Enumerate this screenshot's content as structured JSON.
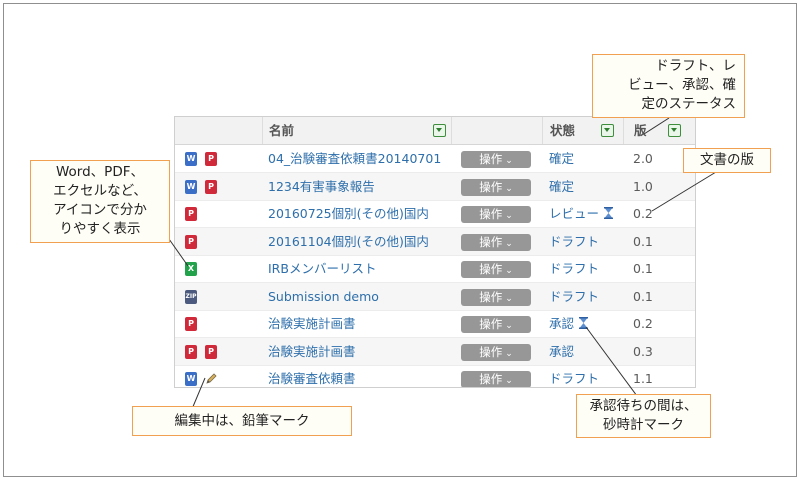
{
  "table": {
    "headers": {
      "name": "名前",
      "state": "状態",
      "version": "版"
    },
    "rows": [
      {
        "icons": [
          "W",
          "P"
        ],
        "name": "04_治験審査依頼書20140701",
        "op": "操作",
        "state": "確定",
        "hourglass": false,
        "version": "2.0"
      },
      {
        "icons": [
          "W",
          "P"
        ],
        "name": "1234有害事象報告",
        "op": "操作",
        "state": "確定",
        "hourglass": false,
        "version": "1.0"
      },
      {
        "icons": [
          "P"
        ],
        "name": "20160725個別(その他)国内",
        "op": "操作",
        "state": "レビュー",
        "hourglass": true,
        "version": "0.2"
      },
      {
        "icons": [
          "P"
        ],
        "name": "20161104個別(その他)国内",
        "op": "操作",
        "state": "ドラフト",
        "hourglass": false,
        "version": "0.1"
      },
      {
        "icons": [
          "X"
        ],
        "name": "IRBメンバーリスト",
        "op": "操作",
        "state": "ドラフト",
        "hourglass": false,
        "version": "0.1"
      },
      {
        "icons": [
          "ZIP"
        ],
        "name": "Submission demo",
        "op": "操作",
        "state": "ドラフト",
        "hourglass": false,
        "version": "0.1"
      },
      {
        "icons": [
          "P"
        ],
        "name": "治験実施計画書",
        "op": "操作",
        "state": "承認",
        "hourglass": true,
        "version": "0.2"
      },
      {
        "icons": [
          "P",
          "P"
        ],
        "name": "治験実施計画書",
        "op": "操作",
        "state": "承認",
        "hourglass": false,
        "version": "0.3"
      },
      {
        "icons": [
          "W",
          "pencil"
        ],
        "name": "治験審査依頼書",
        "op": "操作",
        "state": "ドラフト",
        "hourglass": false,
        "version": "1.1"
      }
    ]
  },
  "callouts": {
    "status": [
      "ドラフト、レ",
      "ビュー、承認、確",
      "定のステータス"
    ],
    "version": [
      "文書の版"
    ],
    "icons": [
      "Word、PDF、",
      "エクセルなど、",
      "アイコンで分か",
      "りやすく表示"
    ],
    "pencil": [
      "編集中は、鉛筆マーク"
    ],
    "hourglass": [
      "承認待ちの間は、",
      "砂時計マーク"
    ]
  },
  "colors": {
    "link": "#2e6fab",
    "op_button": "#979797",
    "callout_border": "#f0a050",
    "word": "#3b6fc7",
    "pdf": "#d02a3a",
    "excel": "#22a24b",
    "zip": "#4b5a7e"
  }
}
